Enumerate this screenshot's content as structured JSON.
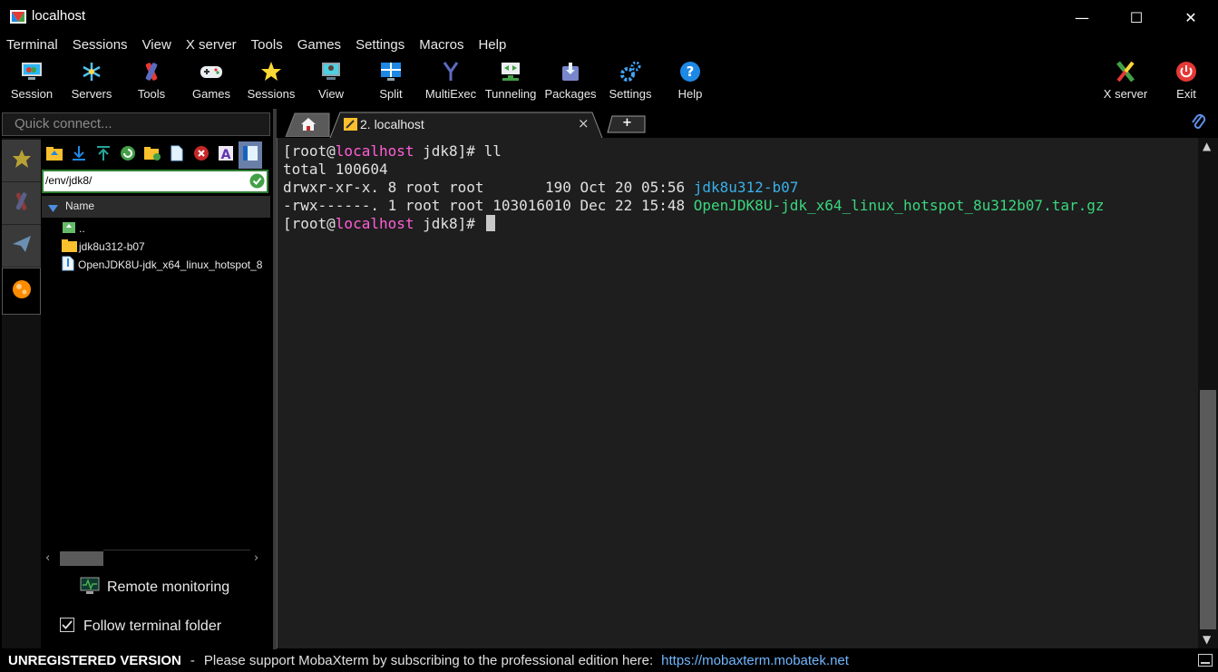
{
  "window": {
    "title": "localhost",
    "minimize": "—",
    "maximize": "☐",
    "close": "✕"
  },
  "menu": [
    "Terminal",
    "Sessions",
    "View",
    "X server",
    "Tools",
    "Games",
    "Settings",
    "Macros",
    "Help"
  ],
  "toolbar": {
    "session": "Session",
    "servers": "Servers",
    "tools": "Tools",
    "games": "Games",
    "sessions": "Sessions",
    "view": "View",
    "split": "Split",
    "multiexec": "MultiExec",
    "tunneling": "Tunneling",
    "packages": "Packages",
    "settings": "Settings",
    "help": "Help",
    "xserver": "X server",
    "exit": "Exit"
  },
  "quick_connect": {
    "placeholder": "Quick connect..."
  },
  "sftp": {
    "path": "/env/jdk8/",
    "column_name": "Name",
    "files": [
      "..",
      "jdk8u312-b07",
      "OpenJDK8U-jdk_x64_linux_hotspot_8"
    ],
    "remote_monitoring": "Remote monitoring",
    "follow_terminal_folder": "Follow terminal folder"
  },
  "tabs": {
    "active_tab": "2. localhost",
    "new_tab": "+"
  },
  "terminal": {
    "lines": [
      {
        "parts": [
          [
            "",
            "[root@"
          ],
          [
            "mag",
            "localhost"
          ],
          [
            "",
            " jdk8]# ll"
          ]
        ]
      },
      {
        "parts": [
          [
            "",
            "total 100604"
          ]
        ]
      },
      {
        "parts": [
          [
            "",
            "drwxr-xr-x. 8 root root       190 Oct 20 05:56 "
          ],
          [
            "blue",
            "jdk8u312-b07"
          ]
        ]
      },
      {
        "parts": [
          [
            "",
            "-rwx------. 1 root root 103016010 Dec 22 15:48 "
          ],
          [
            "green",
            "OpenJDK8U-jdk_x64_linux_hotspot_8u312b07.tar.gz"
          ]
        ]
      },
      {
        "parts": [
          [
            "",
            "[root@"
          ],
          [
            "mag",
            "localhost"
          ],
          [
            "",
            " jdk8]# "
          ]
        ],
        "cursor": true
      }
    ]
  },
  "status": {
    "unregistered": "UNREGISTERED VERSION",
    "separator": "-",
    "message": "Please support MobaXterm by subscribing to the professional edition here:",
    "link": "https://mobaxterm.mobatek.net"
  },
  "colors": {
    "accent": "#2e7d32",
    "link": "#3ab0e8",
    "host": "#ff5fd7",
    "file_green": "#3bd67e"
  }
}
